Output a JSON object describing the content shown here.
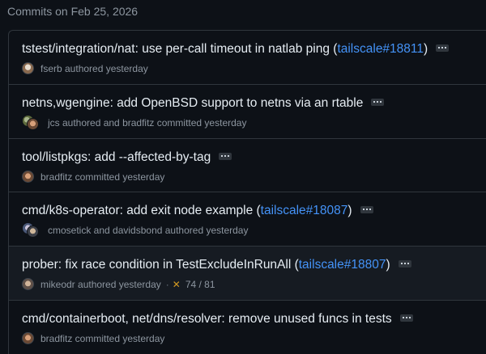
{
  "date_header": "Commits on Feb 25, 2026",
  "commits": [
    {
      "message": "tstest/integration/nat: use per-call timeout in natlab ping (",
      "link": "tailscale#18811",
      "message_suffix": ")",
      "meta": "fserb authored yesterday",
      "avatar": "fserb-avatar"
    },
    {
      "message": "netns,wgengine: add OpenBSD support to netns via an rtable",
      "meta": "jcs authored and bradfitz committed yesterday",
      "avatar": "jcs-bradfitz-avatars"
    },
    {
      "message": "tool/listpkgs: add --affected-by-tag",
      "meta": "bradfitz committed yesterday",
      "avatar": "bradfitz-avatar"
    },
    {
      "message": "cmd/k8s-operator: add exit node example (",
      "link": "tailscale#18087",
      "message_suffix": ")",
      "meta": "cmosetick and davidsbond authored yesterday",
      "avatar": "cmosetick-davidsbond-avatars"
    },
    {
      "message": "prober: fix race condition in TestExcludeInRunAll (",
      "link": "tailscale#18807",
      "message_suffix": ")",
      "meta": "mikeodr authored yesterday",
      "separator": "·",
      "status_icon": "✕",
      "checks": "74 / 81",
      "avatar": "mikeodr-avatar"
    },
    {
      "message": "cmd/containerboot, net/dns/resolver: remove unused funcs in tests",
      "meta": "bradfitz committed yesterday",
      "avatar": "bradfitz-avatar"
    }
  ],
  "colors": {
    "background": "#0d1117",
    "border": "#30363d",
    "link": "#4493f8",
    "muted_text": "#8d96a0",
    "warning": "#d29922"
  }
}
